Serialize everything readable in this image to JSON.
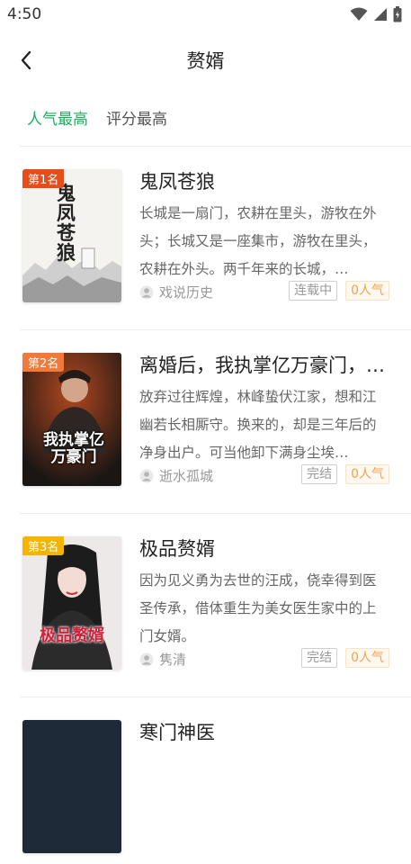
{
  "status_bar": {
    "time": "4:50"
  },
  "header": {
    "title": "赘婿"
  },
  "tabs": [
    {
      "label": "人气最高",
      "active": true
    },
    {
      "label": "评分最高",
      "active": false
    }
  ],
  "books": [
    {
      "rank": "第1名",
      "rank_color": "#e84c1a",
      "cover_title": "鬼凤苍狼",
      "title": "鬼凤苍狼",
      "description": "长城是一扇门，农耕在里头，游牧在外头；长城又是一座集市，游牧在里头，农耕在外头。两千年来的长城，…",
      "author": "戏说历史",
      "status": "连载中",
      "popularity": "0人气"
    },
    {
      "rank": "第2名",
      "rank_color": "#f07a3a",
      "cover_title": "我执掌亿万豪门",
      "title": "离婚后，我执掌亿万豪门，…",
      "description": "放弃过往辉煌，林峰蛰伏江家，想和江幽若长相厮守。换来的，却是三年后的净身出户。可当他卸下满身尘埃…",
      "author": "逝水孤城",
      "status": "完结",
      "popularity": "0人气"
    },
    {
      "rank": "第3名",
      "rank_color": "#f5b400",
      "cover_title": "极品赘婿",
      "title": "极品赘婿",
      "description": "因为见义勇为去世的汪成，侥幸得到医圣传承，借体重生为美女医生家中的上门女婿。",
      "author": "隽清",
      "status": "完结",
      "popularity": "0人气"
    },
    {
      "title": "寒门神医"
    }
  ],
  "colors": {
    "accent": "#17b15e",
    "popularity_text": "#f5a04d"
  }
}
